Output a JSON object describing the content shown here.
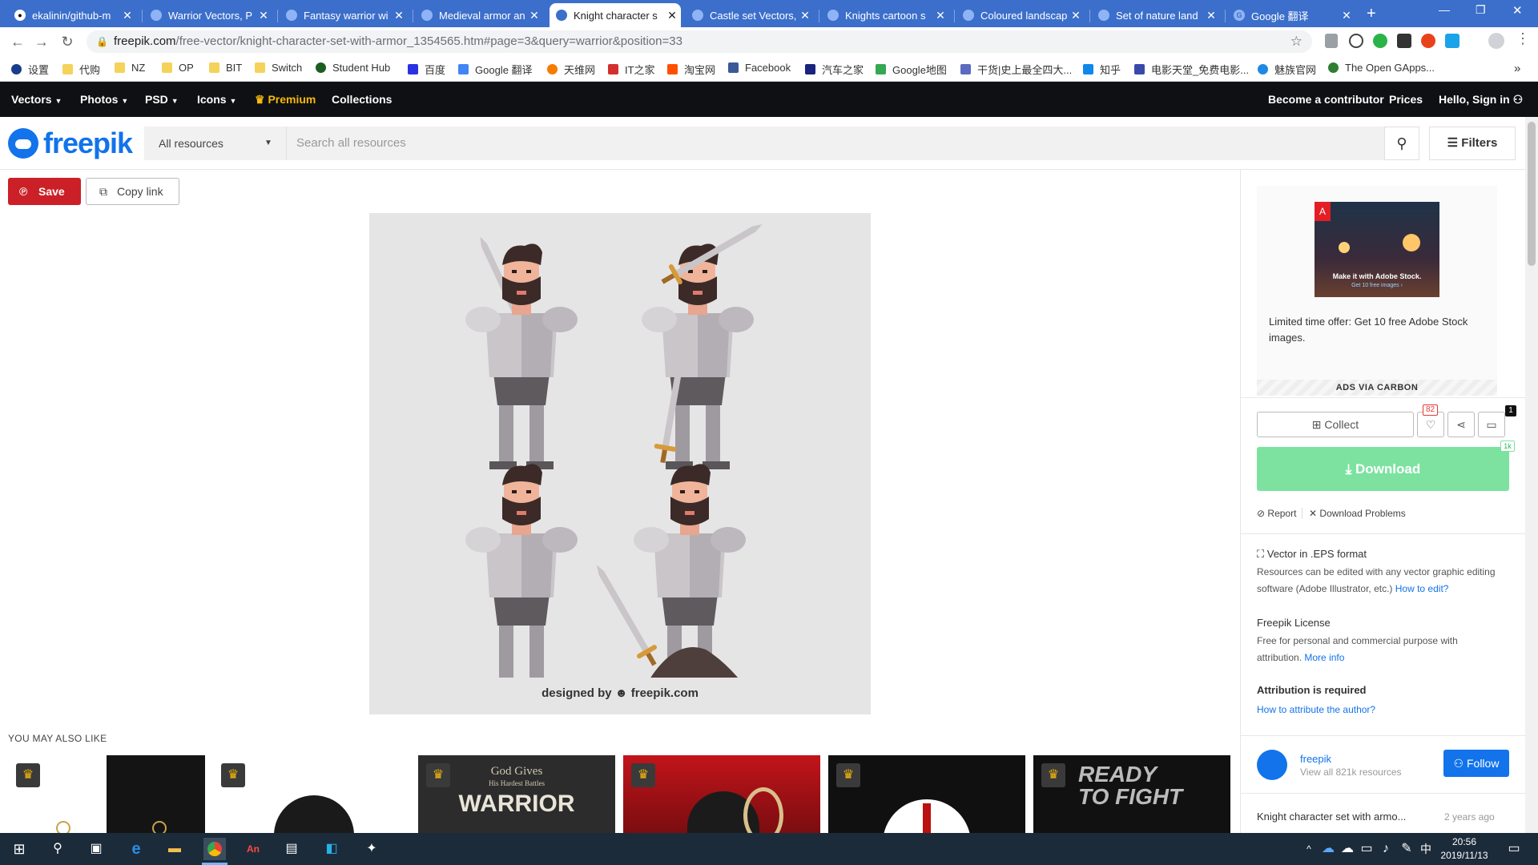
{
  "browser": {
    "tabs": [
      {
        "title": "ekalinin/github-m",
        "active": false
      },
      {
        "title": "Warrior Vectors, P",
        "active": false
      },
      {
        "title": "Fantasy warrior wi",
        "active": false
      },
      {
        "title": "Medieval armor an",
        "active": false
      },
      {
        "title": "Knight character s",
        "active": true
      },
      {
        "title": "Castle set Vectors,",
        "active": false
      },
      {
        "title": "Knights cartoon s",
        "active": false
      },
      {
        "title": "Coloured landscap",
        "active": false
      },
      {
        "title": "Set of nature land",
        "active": false
      },
      {
        "title": "Google 翻译",
        "active": false
      }
    ],
    "new_tab": "+",
    "url_host": "freepik.com",
    "url_path": "/free-vector/knight-character-set-with-armor_1354565.htm#page=3&query=warrior&position=33",
    "bookmarks": [
      "设置",
      "代购",
      "NZ",
      "OP",
      "BIT",
      "Switch",
      "Student Hub",
      "百度",
      "Google 翻译",
      "天维网",
      "IT之家",
      "淘宝网",
      "Facebook",
      "汽车之家",
      "Google地图",
      "干货|史上最全四大...",
      "知乎",
      "电影天堂_免费电影...",
      "魅族官网",
      "The Open GApps..."
    ]
  },
  "nav": {
    "vectors": "Vectors",
    "photos": "Photos",
    "psd": "PSD",
    "icons": "Icons",
    "premium": "Premium",
    "collections": "Collections",
    "contributor": "Become a contributor",
    "prices": "Prices",
    "signin": "Hello, Sign in"
  },
  "header": {
    "logo": "freepik",
    "resource_select": "All resources",
    "search_placeholder": "Search all resources",
    "filters": "Filters"
  },
  "actions": {
    "save": "Save",
    "copy_link": "Copy link"
  },
  "image": {
    "credit_prefix": "designed by",
    "credit_brand": "freepik.com"
  },
  "related": {
    "title": "YOU MAY ALSO LIKE",
    "thumb_texts": [
      "God Gives",
      "His Hardest Battles",
      "WARRIOR",
      "READY",
      "TO FIGHT"
    ]
  },
  "sidebar": {
    "ad_image_text": "Make it with Adobe Stock.",
    "ad_image_subtext": "Get 10 free images ›",
    "ad_text": "Limited time offer: Get 10 free Adobe Stock images.",
    "ad_footer": "ADS VIA CARBON",
    "collect": "Collect",
    "likes": "82",
    "comments": "1",
    "download": "Download",
    "download_count": "1k",
    "report": "Report",
    "download_problems": "Download Problems",
    "format_title": "Vector in .EPS format",
    "format_desc": "Resources can be edited with any vector graphic editing software (Adobe Illustrator, etc.)",
    "how_to_edit": "How to edit?",
    "license_title": "Freepik License",
    "license_desc": "Free for personal and commercial purpose with attribution.",
    "more_info": "More info",
    "attribution_title": "Attribution is required",
    "attribution_link": "How to attribute the author?",
    "author_name": "freepik",
    "author_resources": "View all 821k resources",
    "follow": "Follow",
    "resource_title": "Knight character set with armo...",
    "resource_age": "2 years ago"
  },
  "taskbar": {
    "time": "20:56",
    "date": "2019/11/13",
    "ime": "中"
  },
  "colors": {
    "freepik_blue": "#1273eb",
    "save_red": "#cb2027",
    "download_green": "#7de2a0",
    "nav_dark": "#0e1013",
    "premium_gold": "#f7b90b",
    "chrome_blue": "#3c6fcb"
  }
}
